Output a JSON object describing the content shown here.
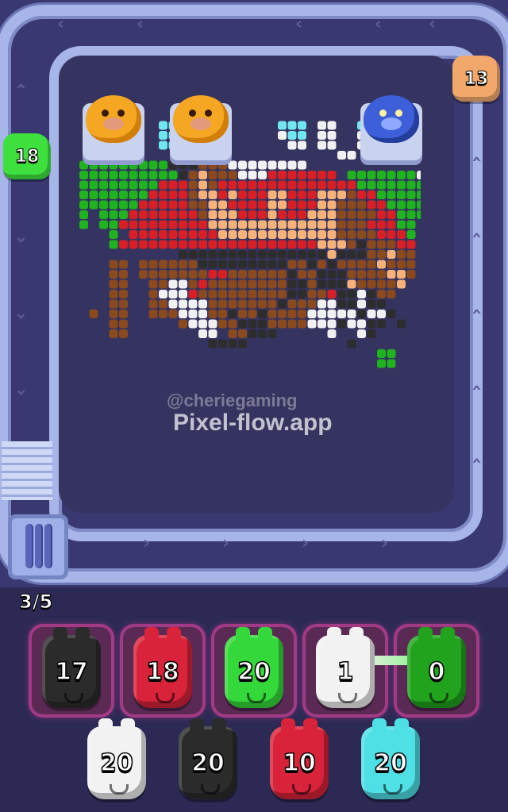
{
  "watermark": {
    "handle": "@cheriegaming",
    "site": "Pixel-flow.app"
  },
  "progress": "3/5",
  "track_pigs": [
    {
      "id": "left",
      "count": "18",
      "color": "#3ee03e"
    },
    {
      "id": "top-right",
      "count": "13",
      "color": "#f2a86b"
    }
  ],
  "shooters": [
    {
      "id": "pumpkin-1",
      "color": "#f5a623"
    },
    {
      "id": "pumpkin-2",
      "color": "#f5a623"
    },
    {
      "id": "pumpkin-3",
      "color": "#3d5fd9"
    }
  ],
  "active_slots": [
    {
      "count": "17",
      "color": "#2b2b2b"
    },
    {
      "count": "18",
      "color": "#d8233a"
    },
    {
      "count": "20",
      "color": "#35d83a"
    },
    {
      "count": "1",
      "color": "#f2f2f2"
    },
    {
      "count": "0",
      "color": "#22a31e"
    }
  ],
  "queue": [
    {
      "count": "20",
      "color": "#f2f2f2"
    },
    {
      "count": "20",
      "color": "#2b2b2b"
    },
    {
      "count": "10",
      "color": "#d8233a"
    },
    {
      "count": "20",
      "color": "#4fe0e6"
    }
  ],
  "palette": {
    "green": "#1fb31f",
    "red": "#d81f26",
    "peach": "#f7b27a",
    "brown": "#8a4a1e",
    "dark": "#2d2d2d",
    "white": "#f1f1f1",
    "cyan": "#6fe6f0",
    "tan": "#c98a5a"
  }
}
